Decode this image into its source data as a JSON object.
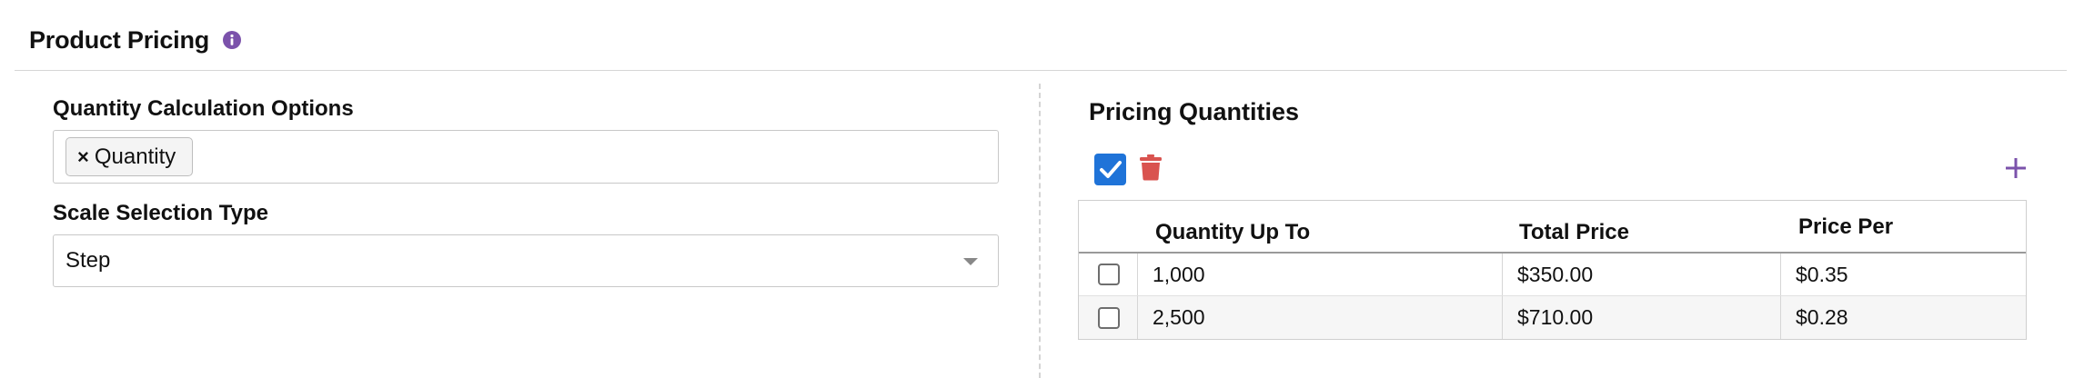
{
  "header": {
    "title": "Product Pricing",
    "info_icon": "info-icon",
    "info_color": "#7b52ab"
  },
  "left": {
    "calc_label": "Quantity Calculation Options",
    "calc_tags": [
      {
        "remove_glyph": "×",
        "label": "Quantity"
      }
    ],
    "scale_label": "Scale Selection Type",
    "scale_value": "Step"
  },
  "right": {
    "title": "Pricing Quantities",
    "select_all_checked": true,
    "accent_color": "#1f73d8",
    "delete_color": "#d9534f",
    "add_color": "#7b52ab",
    "columns": [
      "Quantity Up To",
      "Total Price",
      "Price Per"
    ],
    "rows": [
      {
        "checked": false,
        "quantity": "1,000",
        "total": "$350.00",
        "per": "$0.35"
      },
      {
        "checked": false,
        "quantity": "2,500",
        "total": "$710.00",
        "per": "$0.28"
      }
    ]
  }
}
